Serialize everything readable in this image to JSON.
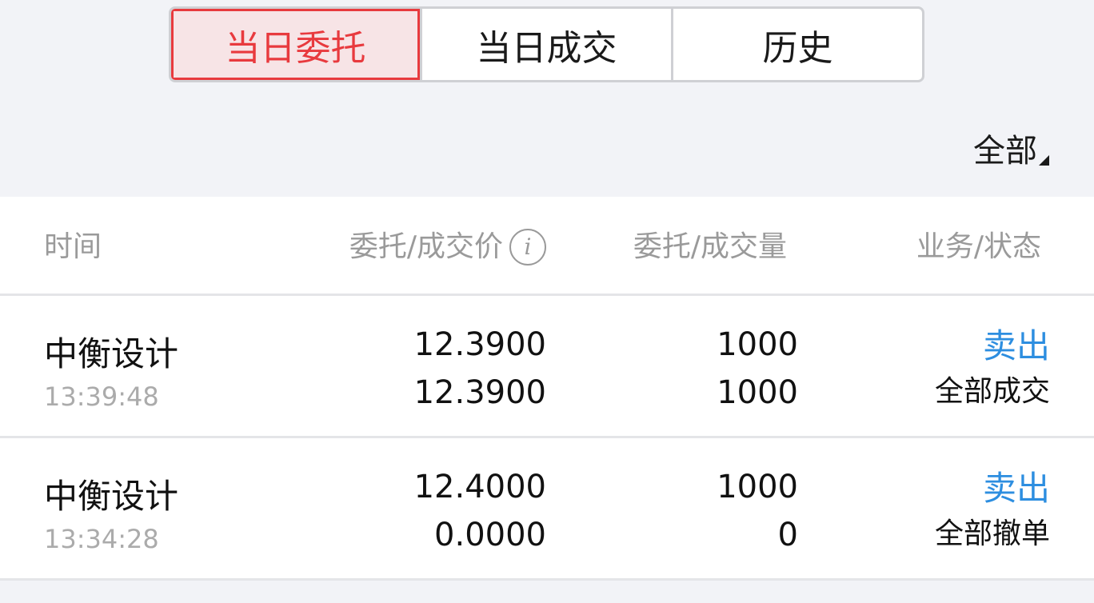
{
  "tabs": [
    {
      "label": "当日委托",
      "active": true
    },
    {
      "label": "当日成交",
      "active": false
    },
    {
      "label": "历史",
      "active": false
    }
  ],
  "filter": {
    "label": "全部"
  },
  "table": {
    "headers": {
      "time": "时间",
      "price": "委托/成交价",
      "volume": "委托/成交量",
      "status": "业务/状态"
    },
    "info_icon_glyph": "i",
    "rows": [
      {
        "name": "中衡设计",
        "time": "13:39:48",
        "order_price": "12.3900",
        "deal_price": "12.3900",
        "order_volume": "1000",
        "deal_volume": "1000",
        "business": "卖出",
        "status": "全部成交"
      },
      {
        "name": "中衡设计",
        "time": "13:34:28",
        "order_price": "12.4000",
        "deal_price": "0.0000",
        "order_volume": "1000",
        "deal_volume": "0",
        "business": "卖出",
        "status": "全部撤单"
      }
    ]
  },
  "colors": {
    "accent_red": "#e83a3e",
    "active_tab_bg": "#f7e4e6",
    "sell_blue": "#2d8ee0",
    "page_bg": "#f2f3f7",
    "header_text": "#9a9a9a"
  },
  "icons": {
    "price_info": "info-icon",
    "filter_caret": "caret-down-icon"
  }
}
